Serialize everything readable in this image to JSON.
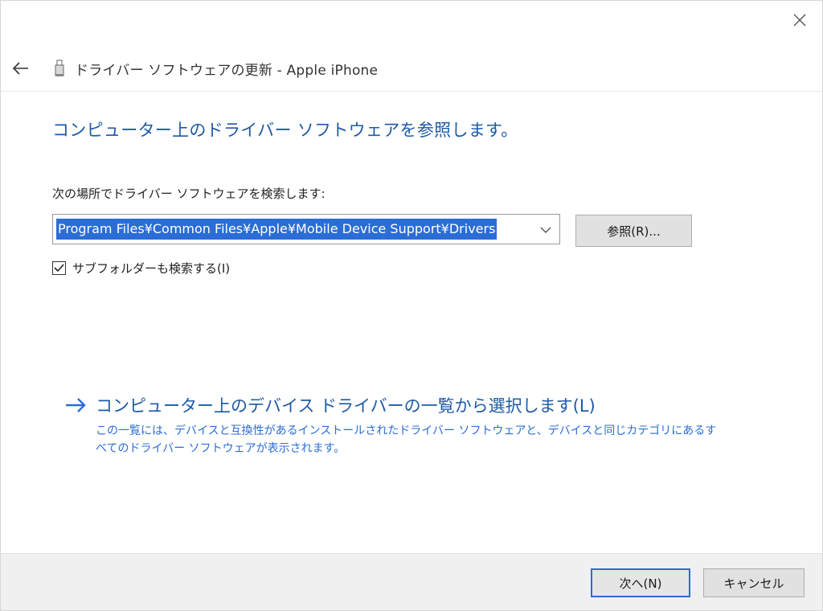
{
  "window": {
    "title": "ドライバー ソフトウェアの更新 - Apple iPhone",
    "close_icon": "close-icon",
    "back_icon": "back-arrow-icon",
    "device_icon": "usb-device-icon"
  },
  "main": {
    "heading": "コンピューター上のドライバー ソフトウェアを参照します。",
    "search_label": "次の場所でドライバー ソフトウェアを検索します:",
    "path_value": "Program Files¥Common Files¥Apple¥Mobile Device Support¥Drivers",
    "browse_label": "参照(R)...",
    "subfolder": {
      "label": "サブフォルダーも検索する(I)",
      "checked": true
    },
    "select_list": {
      "title": "コンピューター上のデバイス ドライバーの一覧から選択します(L)",
      "description": "この一覧には、デバイスと互換性があるインストールされたドライバー ソフトウェアと、デバイスと同じカテゴリにあるすべてのドライバー ソフトウェアが表示されます。"
    }
  },
  "footer": {
    "next_label": "次へ(N)",
    "cancel_label": "キャンセル"
  },
  "colors": {
    "heading_blue": "#1f5aa6",
    "link_blue": "#2a6dd6",
    "selection_blue": "#2a6dd6",
    "footer_bg": "#f0f0f0"
  }
}
